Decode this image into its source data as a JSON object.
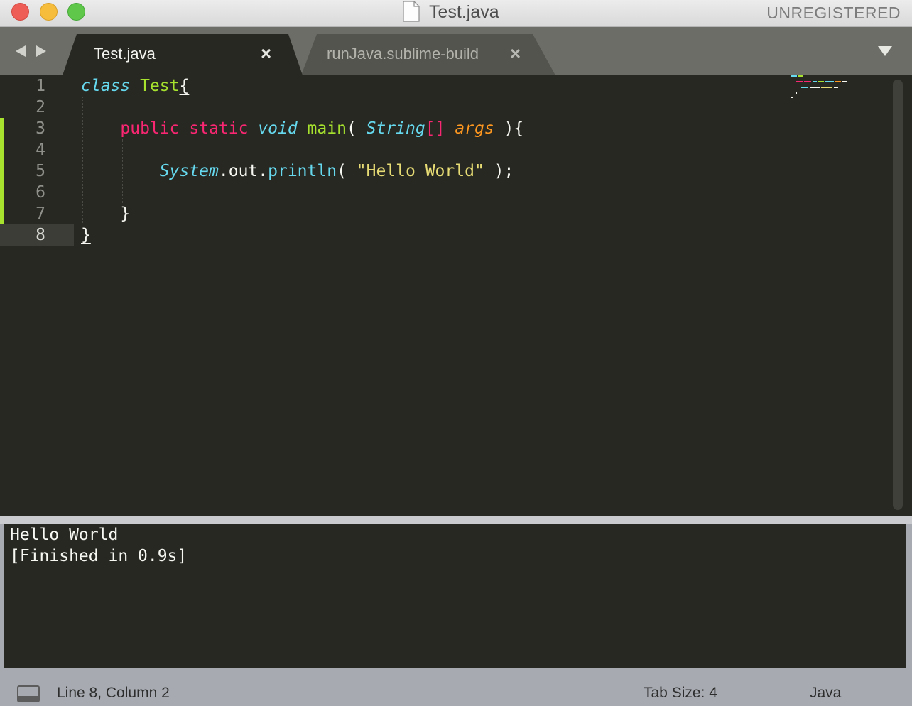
{
  "window": {
    "title": "Test.java",
    "registration": "UNREGISTERED"
  },
  "tabs": [
    {
      "label": "Test.java",
      "close": "×"
    },
    {
      "label": "runJava.sublime-build",
      "close": "×"
    }
  ],
  "editor": {
    "line_numbers": [
      "1",
      "2",
      "3",
      "4",
      "5",
      "6",
      "7",
      "8"
    ],
    "current_line": 8,
    "code": {
      "l1": {
        "kw": "class",
        "sp": " ",
        "name": "Test",
        "brace": "{"
      },
      "l3": {
        "indent": "    ",
        "mod1": "public",
        "sp1": " ",
        "mod2": "static",
        "sp2": " ",
        "ret": "void",
        "sp3": " ",
        "fn": "main",
        "open": "( ",
        "type": "String",
        "arr": "[]",
        "sp4": " ",
        "arg": "args",
        "close": " ){"
      },
      "l5": {
        "indent": "        ",
        "obj": "System",
        "dot1": ".",
        "field": "out",
        "dot2": ".",
        "fn": "println",
        "open": "( ",
        "str": "\"Hello World\"",
        "close": " );"
      },
      "l7": {
        "indent": "    ",
        "brace": "}"
      },
      "l8": {
        "brace": "}"
      }
    }
  },
  "output": {
    "lines": [
      "Hello World",
      "[Finished in 0.9s]"
    ]
  },
  "status": {
    "position": "Line 8, Column 2",
    "tab_size": "Tab Size: 4",
    "syntax": "Java"
  },
  "colors": {
    "editor_bg": "#272822",
    "keyword": "#f92672",
    "type": "#66d9ef",
    "function": "#a6e22e",
    "argument": "#fd971f",
    "string": "#e6db74"
  },
  "icons": {
    "nav_back": "triangle-left-icon",
    "nav_forward": "triangle-right-icon",
    "tab_menu": "triangle-down-icon",
    "document": "document-icon",
    "panel_toggle": "panel-icon"
  }
}
